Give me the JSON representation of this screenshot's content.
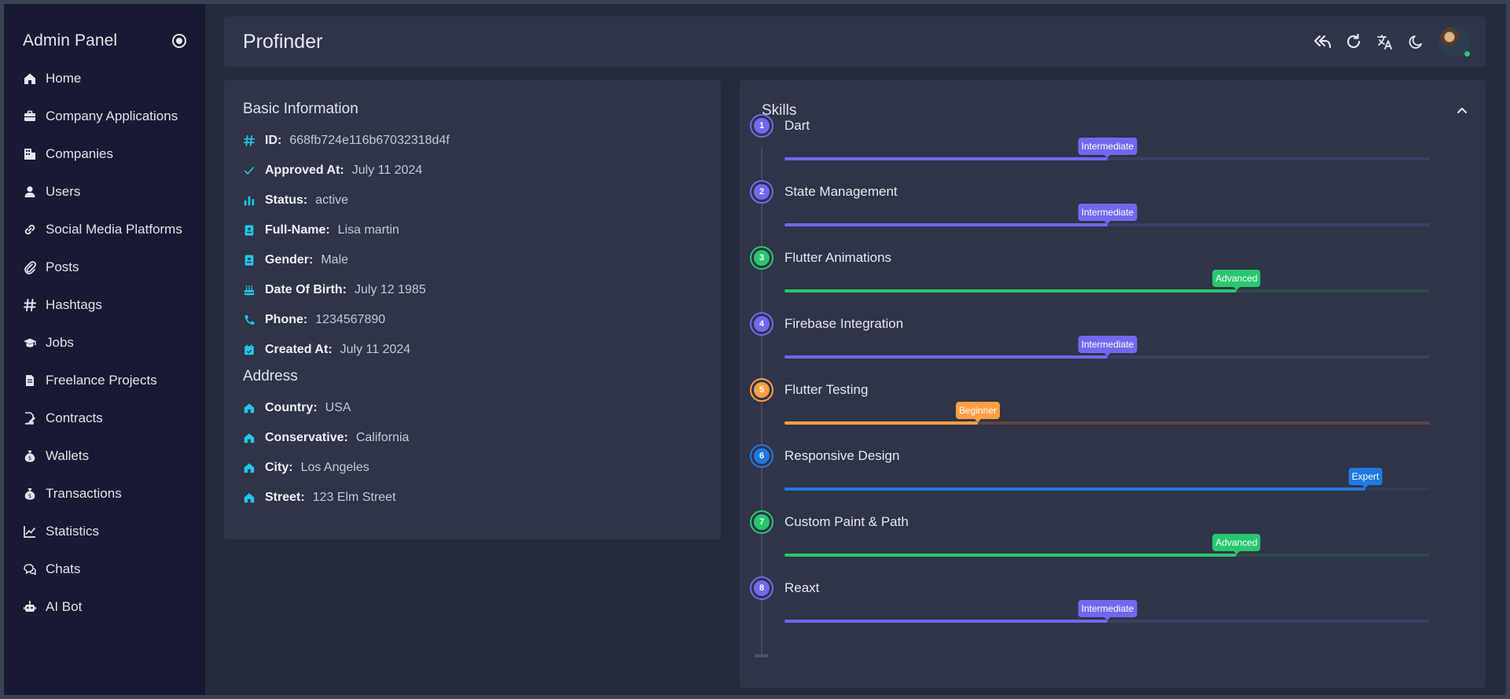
{
  "sidebar": {
    "brand": "Admin Panel",
    "items": [
      {
        "label": "Home",
        "icon": "home-icon"
      },
      {
        "label": "Company Applications",
        "icon": "briefcase-icon"
      },
      {
        "label": "Companies",
        "icon": "building-icon"
      },
      {
        "label": "Users",
        "icon": "user-icon"
      },
      {
        "label": "Social Media Platforms",
        "icon": "link-icon"
      },
      {
        "label": "Posts",
        "icon": "paperclip-icon"
      },
      {
        "label": "Hashtags",
        "icon": "hashtag-icon"
      },
      {
        "label": "Jobs",
        "icon": "graduation-cap-icon"
      },
      {
        "label": "Freelance Projects",
        "icon": "file-icon"
      },
      {
        "label": "Contracts",
        "icon": "contract-icon"
      },
      {
        "label": "Wallets",
        "icon": "money-bag-icon"
      },
      {
        "label": "Transactions",
        "icon": "money-bag-icon"
      },
      {
        "label": "Statistics",
        "icon": "chart-line-icon"
      },
      {
        "label": "Chats",
        "icon": "chat-icon"
      },
      {
        "label": "AI Bot",
        "icon": "robot-icon"
      }
    ]
  },
  "header": {
    "title": "Profinder"
  },
  "basic_info": {
    "title": "Basic Information",
    "rows": [
      {
        "label": "ID:",
        "value": "668fb724e116b67032318d4f",
        "icon": "hashtag-icon"
      },
      {
        "label": "Approved At:",
        "value": "July 11 2024",
        "icon": "check-icon"
      },
      {
        "label": "Status:",
        "value": "active",
        "icon": "bar-chart-icon"
      },
      {
        "label": "Full-Name:",
        "value": "Lisa martin",
        "icon": "id-badge-icon"
      },
      {
        "label": "Gender:",
        "value": "Male",
        "icon": "id-badge-icon"
      },
      {
        "label": "Date Of Birth:",
        "value": "July 12 1985",
        "icon": "cake-icon"
      },
      {
        "label": "Phone:",
        "value": "1234567890",
        "icon": "phone-icon"
      },
      {
        "label": "Created At:",
        "value": "July 11 2024",
        "icon": "calendar-icon"
      }
    ]
  },
  "address": {
    "title": "Address",
    "rows": [
      {
        "label": "Country:",
        "value": "USA",
        "icon": "home-icon"
      },
      {
        "label": "Conservative:",
        "value": "California",
        "icon": "home-icon"
      },
      {
        "label": "City:",
        "value": "Los Angeles",
        "icon": "home-icon"
      },
      {
        "label": "Street:",
        "value": "123 Elm Street",
        "icon": "home-icon"
      }
    ]
  },
  "skills": {
    "title": "Skills",
    "items": [
      {
        "num": "1",
        "name": "Dart",
        "level": "Intermediate",
        "progress": 0.5,
        "color": "#7367f0",
        "track": "#3b3f66"
      },
      {
        "num": "2",
        "name": "State Management",
        "level": "Intermediate",
        "progress": 0.5,
        "color": "#7367f0",
        "track": "#3b3f66"
      },
      {
        "num": "3",
        "name": "Flutter Animations",
        "level": "Advanced",
        "progress": 0.7,
        "color": "#28c76f",
        "track": "#2c4a48"
      },
      {
        "num": "4",
        "name": "Firebase Integration",
        "level": "Intermediate",
        "progress": 0.5,
        "color": "#7367f0",
        "track": "#3b3f66"
      },
      {
        "num": "5",
        "name": "Flutter Testing",
        "level": "Beginner",
        "progress": 0.3,
        "color": "#ff9f43",
        "track": "#5a4640"
      },
      {
        "num": "6",
        "name": "Responsive Design",
        "level": "Expert",
        "progress": 0.9,
        "color": "#1f7ae0",
        "track": "#2b3d5c"
      },
      {
        "num": "7",
        "name": "Custom Paint & Path",
        "level": "Advanced",
        "progress": 0.7,
        "color": "#28c76f",
        "track": "#2c4a48"
      },
      {
        "num": "8",
        "name": "Reaxt",
        "level": "Intermediate",
        "progress": 0.5,
        "color": "#7367f0",
        "track": "#3b3f66"
      }
    ]
  }
}
